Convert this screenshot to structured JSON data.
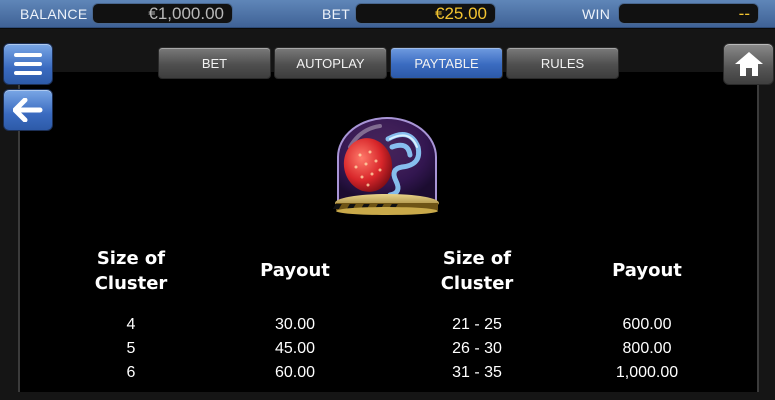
{
  "status_bar": {
    "balance_label": "BALANCE",
    "balance_value": "€1,000.00",
    "bet_label": "BET",
    "bet_value": "€25.00",
    "win_label": "WIN",
    "win_value": "--"
  },
  "tabs": [
    {
      "label": "BET",
      "active": false
    },
    {
      "label": "AUTOPLAY",
      "active": false
    },
    {
      "label": "PAYTABLE",
      "active": true
    },
    {
      "label": "RULES",
      "active": false
    }
  ],
  "buttons": {
    "menu_icon": "hamburger-menu-icon",
    "back_icon": "arrow-left-icon",
    "home_icon": "home-icon"
  },
  "symbol": {
    "icon": "strawberry-in-glass-dome-icon"
  },
  "paytable": {
    "headers": {
      "size_left_line1": "Size of",
      "size_left_line2": "Cluster",
      "payout_left": "Payout",
      "size_right_line1": "Size of",
      "size_right_line2": "Cluster",
      "payout_right": "Payout"
    },
    "rows": [
      {
        "size_left": "4",
        "payout_left": "30.00",
        "size_right": "21 - 25",
        "payout_right": "600.00"
      },
      {
        "size_left": "5",
        "payout_left": "45.00",
        "size_right": "26 - 30",
        "payout_right": "800.00"
      },
      {
        "size_left": "6",
        "payout_left": "60.00",
        "size_right": "31 - 35",
        "payout_right": "1,000.00"
      }
    ]
  },
  "colors": {
    "accent_blue": "#3a6bc0",
    "highlight_yellow": "#f3c430",
    "panel_background": "#000000"
  }
}
